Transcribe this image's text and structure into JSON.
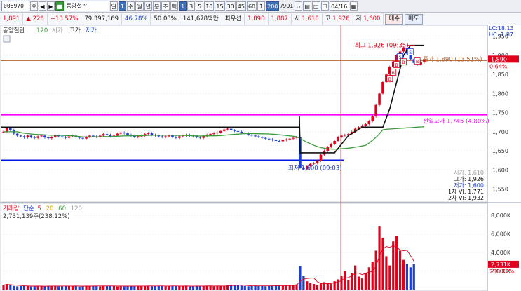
{
  "toolbar": {
    "code": "008970",
    "stock_name": "동양철관",
    "period_buttons": [
      "일",
      "1",
      "주",
      "월",
      "년",
      "분",
      "초",
      "틱",
      "1",
      "3",
      "5",
      "10",
      "15",
      "30",
      "45",
      "60",
      "1"
    ],
    "count": "200",
    "count_total": "/901",
    "date": "04/16"
  },
  "info": {
    "price": "1,891",
    "change": "226",
    "change_pct": "+13.57%",
    "volume": "79,397,169",
    "vol_ratio": "46.78%",
    "strength": "50.03%",
    "amount": "141,678백만",
    "best_ask_label": "최우선",
    "best_ask": "1,890",
    "best_bid": "1,887",
    "open_label": "시",
    "open": "1,610",
    "high_label": "고",
    "high": "1,926",
    "low_label": "저",
    "low": "1,600",
    "buy_label": "매수",
    "sell_label": "매도"
  },
  "price_panel": {
    "legend_name": "동양철관",
    "legend_period": "120",
    "legend_open": "시가",
    "legend_high": "고가",
    "legend_low": "저가",
    "lc": "LC:18.13",
    "hc": "HC:-1.87",
    "y_ticks": [
      "1,950",
      "1,900",
      "1,850",
      "1,800",
      "1,750",
      "1,700",
      "1,650",
      "1,600",
      "1,550"
    ],
    "current_price_label": "1,890",
    "current_pct_label": "0.64%",
    "annotation_high": "최고 1,926 (09:35)",
    "annotation_low": "최저 1,600 (09:03)",
    "annotation_prev_high": "전일고가 1,745 (4.80%)",
    "annotation_close": "종가 1,890 (13.51%)",
    "summary_open": "시가: 1,610",
    "summary_high": "고가: 1,926",
    "summary_low": "저가: 1,600",
    "summary_vi1": "1차 VI: 1,771",
    "summary_vi2": "2차 VI: 1,932",
    "accent_magenta": "#ff00ff",
    "accent_blue": "#0018e6",
    "accent_brown": "#b4622d"
  },
  "volume_panel": {
    "legend_title": "거래량",
    "legend_type": "단순",
    "legend_ma5": "5",
    "legend_ma20": "20",
    "legend_ma60": "60",
    "legend_ma120": "120",
    "current_volume": "2,731,139주(238.12%)",
    "y_ticks": [
      "8,000K",
      "6,000K",
      "4,000K",
      "2,000K"
    ],
    "current_label": "2,731K",
    "current_pct": "238.12%"
  },
  "chart_data": [
    {
      "type": "candlestick",
      "title": "동양철관",
      "ylim": [
        1520,
        1975
      ],
      "open": 1610,
      "high": 1926,
      "low": 1600,
      "close": 1890,
      "prev_high": 1745,
      "vi1": 1771,
      "vi2": 1932,
      "close_series": [
        1700,
        1710,
        1705,
        1695,
        1690,
        1688,
        1685,
        1690,
        1686,
        1684,
        1688,
        1690,
        1685,
        1683,
        1686,
        1690,
        1688,
        1686,
        1684,
        1688,
        1690,
        1686,
        1684,
        1682,
        1686,
        1690,
        1688,
        1686,
        1690,
        1694,
        1692,
        1688,
        1690,
        1695,
        1698,
        1696,
        1692,
        1690,
        1686,
        1688,
        1690,
        1694,
        1696,
        1692,
        1690,
        1688,
        1686,
        1688,
        1690,
        1686,
        1684,
        1688,
        1690,
        1692,
        1690,
        1688,
        1686,
        1684,
        1688,
        1692,
        1694,
        1696,
        1698,
        1702,
        1706,
        1708,
        1704,
        1702,
        1700,
        1698,
        1696,
        1692,
        1690,
        1688,
        1686,
        1684,
        1682,
        1680,
        1678,
        1676,
        1675,
        1678,
        1680,
        1682,
        1684,
        1686,
        1606,
        1602,
        1610,
        1616,
        1618,
        1624,
        1640,
        1650,
        1660,
        1668,
        1676,
        1686,
        1690,
        1692,
        1694,
        1700,
        1708,
        1712,
        1716,
        1720,
        1728,
        1740,
        1770,
        1800,
        1830,
        1850,
        1870,
        1884,
        1900,
        1910,
        1920,
        1904,
        1890,
        1880,
        1876,
        1882,
        1890
      ]
    },
    {
      "type": "bar",
      "title": "거래량",
      "ylim": [
        0,
        9000
      ],
      "unit": "K",
      "values": [
        500,
        600,
        500,
        400,
        350,
        380,
        420,
        400,
        330,
        350,
        420,
        380,
        350,
        400,
        380,
        420,
        360,
        350,
        420,
        390,
        380,
        420,
        330,
        350,
        420,
        380,
        420,
        390,
        340,
        420,
        380,
        420,
        390,
        330,
        420,
        360,
        400,
        380,
        350,
        420,
        380,
        390,
        420,
        360,
        380,
        400,
        420,
        360,
        380,
        420,
        380,
        360,
        400,
        420,
        330,
        360,
        420,
        400,
        380,
        420,
        380,
        360,
        420,
        400,
        380,
        450,
        500,
        520,
        480,
        420,
        380,
        360,
        420,
        440,
        400,
        380,
        360,
        420,
        440,
        460,
        420,
        400,
        420,
        480,
        520,
        560,
        2500,
        1500,
        900,
        700,
        600,
        500,
        650,
        800,
        700,
        600,
        900,
        1100,
        1500,
        2000,
        1000,
        1800,
        2600,
        1400,
        1200,
        1800,
        2400,
        3000,
        4200,
        6800,
        5600,
        3600,
        2600,
        5200,
        5800,
        4200,
        3200,
        2800,
        2400,
        2731
      ]
    }
  ]
}
